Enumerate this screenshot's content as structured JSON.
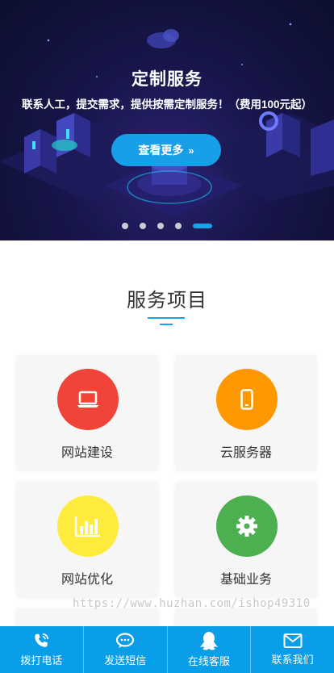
{
  "banner": {
    "title": "定制服务",
    "subtitle": "联系人工，提交需求，提供按需定制服务！（费用100元起）",
    "button_label": "查看更多",
    "button_icon": "double-chevron-right-icon",
    "slide_count": 5,
    "active_slide": 5
  },
  "services": {
    "title": "服务项目",
    "items": [
      {
        "label": "网站建设",
        "icon": "laptop-icon",
        "color": "#f04438"
      },
      {
        "label": "云服务器",
        "icon": "mobile-phone-icon",
        "color": "#ff9800"
      },
      {
        "label": "网站优化",
        "icon": "bar-chart-icon",
        "color": "#ffeb3b"
      },
      {
        "label": "基础业务",
        "icon": "gear-icon",
        "color": "#4caf50"
      }
    ]
  },
  "watermark": "https://www.huzhan.com/ishop49310",
  "bottom_nav": [
    {
      "label": "拨打电话",
      "icon": "phone-icon"
    },
    {
      "label": "发送短信",
      "icon": "chat-bubble-icon"
    },
    {
      "label": "在线客服",
      "icon": "qq-penguin-icon"
    },
    {
      "label": "联系我们",
      "icon": "envelope-icon"
    }
  ],
  "colors": {
    "accent": "#1aa3ea",
    "nav_bg": "#0a9ee8",
    "banner_bg": "#17154a"
  }
}
